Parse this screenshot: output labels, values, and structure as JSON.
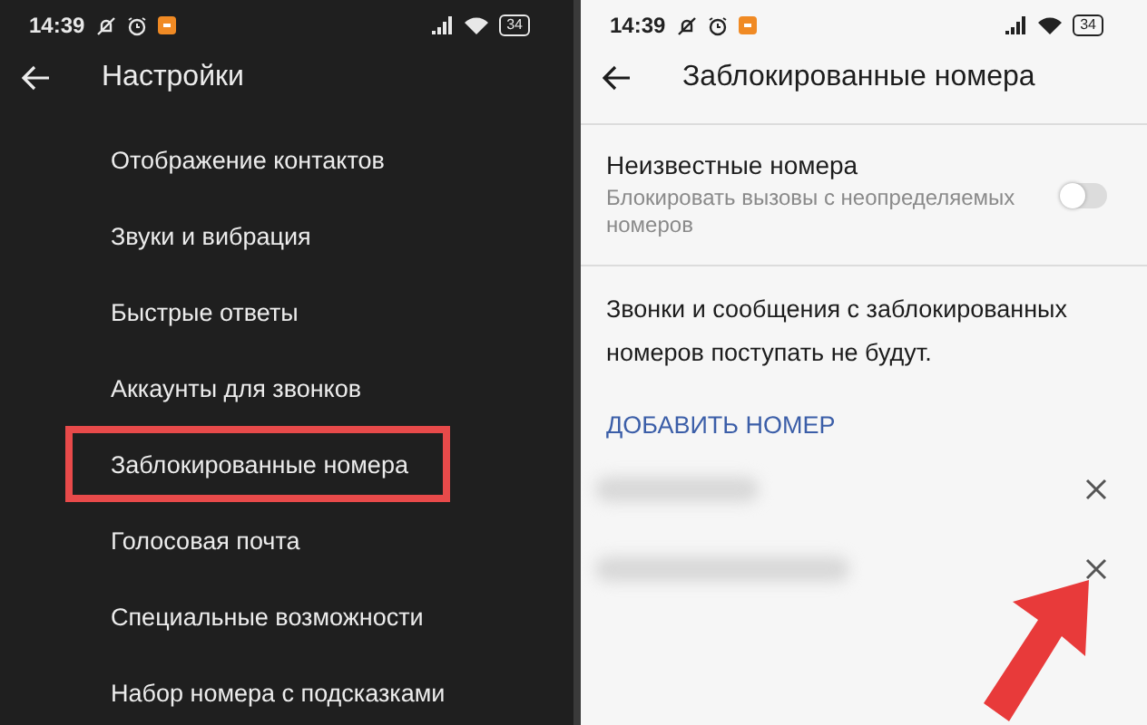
{
  "screens": [
    {
      "kind": "dark",
      "status_bar": {
        "time": "14:39",
        "battery": "34"
      },
      "title": "Настройки",
      "items": [
        {
          "label": "Отображение контактов",
          "highlighted": false
        },
        {
          "label": "Звуки и вибрация",
          "highlighted": false
        },
        {
          "label": "Быстрые ответы",
          "highlighted": false
        },
        {
          "label": "Аккаунты для звонков",
          "highlighted": false
        },
        {
          "label": "Заблокированные номера",
          "highlighted": true
        },
        {
          "label": "Голосовая почта",
          "highlighted": false
        },
        {
          "label": "Специальные возможности",
          "highlighted": false
        },
        {
          "label": "Набор номера с подсказками",
          "highlighted": false
        }
      ]
    },
    {
      "kind": "light",
      "status_bar": {
        "time": "14:39",
        "battery": "34"
      },
      "title": "Заблокированные номера",
      "setting": {
        "label": "Неизвестные номера",
        "description": "Блокировать вызовы с неопределяемых номеров",
        "on": false
      },
      "note": "Звонки и сообщения с заблокированных номеров поступать не будут.",
      "add_button": "ДОБАВИТЬ НОМЕР",
      "blocked_numbers": [
        {
          "kind": "redacted"
        },
        {
          "kind": "redacted"
        }
      ],
      "pointer_arrow": true
    }
  ]
}
